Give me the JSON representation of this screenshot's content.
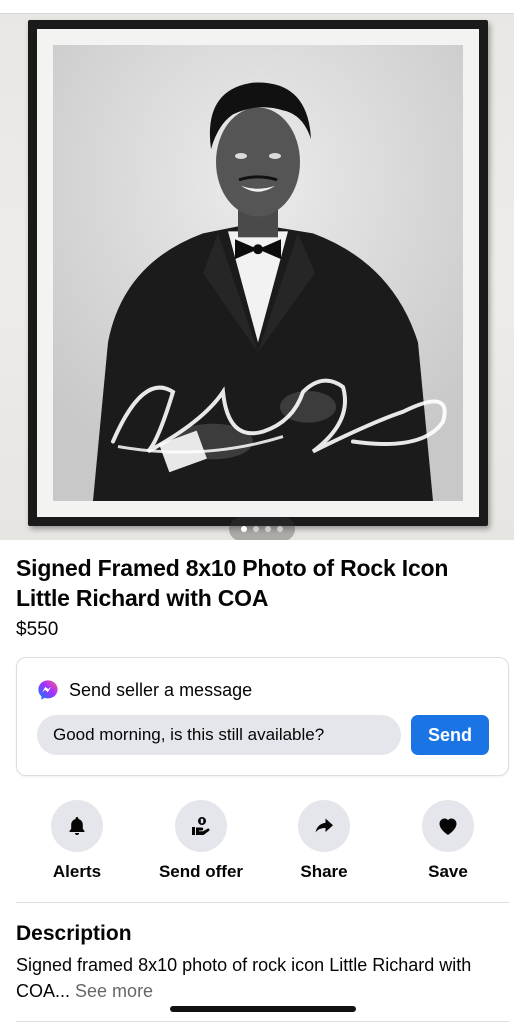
{
  "listing": {
    "image_alt": "Framed signed black and white photo of Little Richard",
    "photo_count": 4,
    "active_photo": 1,
    "signature_text": "Little Richard",
    "title": "Signed Framed 8x10 Photo of Rock Icon Little Richard with COA",
    "price": "$550"
  },
  "message": {
    "heading": "Send seller a message",
    "input_value": "Good morning, is this still available?",
    "send_label": "Send",
    "icon": "messenger-icon"
  },
  "actions": [
    {
      "label": "Alerts",
      "icon": "bell-icon"
    },
    {
      "label": "Send offer",
      "icon": "send-offer-icon"
    },
    {
      "label": "Share",
      "icon": "share-icon"
    },
    {
      "label": "Save",
      "icon": "heart-icon"
    }
  ],
  "description": {
    "heading": "Description",
    "text": "Signed framed 8x10 photo of rock icon Little Richard with COA...",
    "see_more": "See more"
  },
  "colors": {
    "accent": "#1b74e4",
    "action_bg": "#e4e6eb",
    "secondary_text": "#65676b"
  }
}
